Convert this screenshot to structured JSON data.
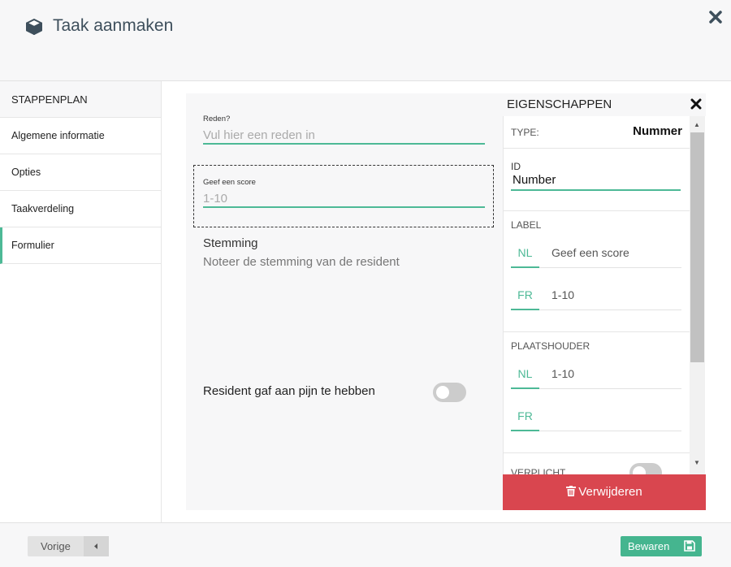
{
  "header": {
    "title": "Taak aanmaken",
    "icon": "cube-icon"
  },
  "sidebar": {
    "title": "STAPPENPLAN",
    "items": [
      {
        "label": "Algemene informatie"
      },
      {
        "label": "Opties"
      },
      {
        "label": "Taakverdeling"
      },
      {
        "label": "Formulier",
        "active": true
      }
    ]
  },
  "form": {
    "reason": {
      "label": "Reden?",
      "placeholder": "Vul hier een reden in"
    },
    "score": {
      "label": "Geef een score",
      "placeholder": "1-10"
    },
    "mood": {
      "title": "Stemming",
      "description": "Noteer de stemming van de resident"
    },
    "pain": {
      "label": "Resident gaf aan pijn te hebben",
      "toggled": false
    }
  },
  "properties": {
    "title": "EIGENSCHAPPEN",
    "type_label": "TYPE:",
    "type_value": "Nummer",
    "id_label": "ID",
    "id_value": "Number",
    "label_section": "LABEL",
    "label_nl_lang": "NL",
    "label_nl_value": "Geef een score",
    "label_fr_lang": "FR",
    "label_fr_value": "1-10",
    "placeholder_section": "PLAATSHOUDER",
    "ph_nl_lang": "NL",
    "ph_nl_value": "1-10",
    "ph_fr_lang": "FR",
    "ph_fr_value": "",
    "required_label": "VERPLICHT",
    "delete_label": "Verwijderen"
  },
  "footer": {
    "prev_label": "Vorige",
    "save_label": "Bewaren"
  },
  "colors": {
    "accent": "#4db996",
    "danger": "#d9464f",
    "save": "#45b58f"
  }
}
